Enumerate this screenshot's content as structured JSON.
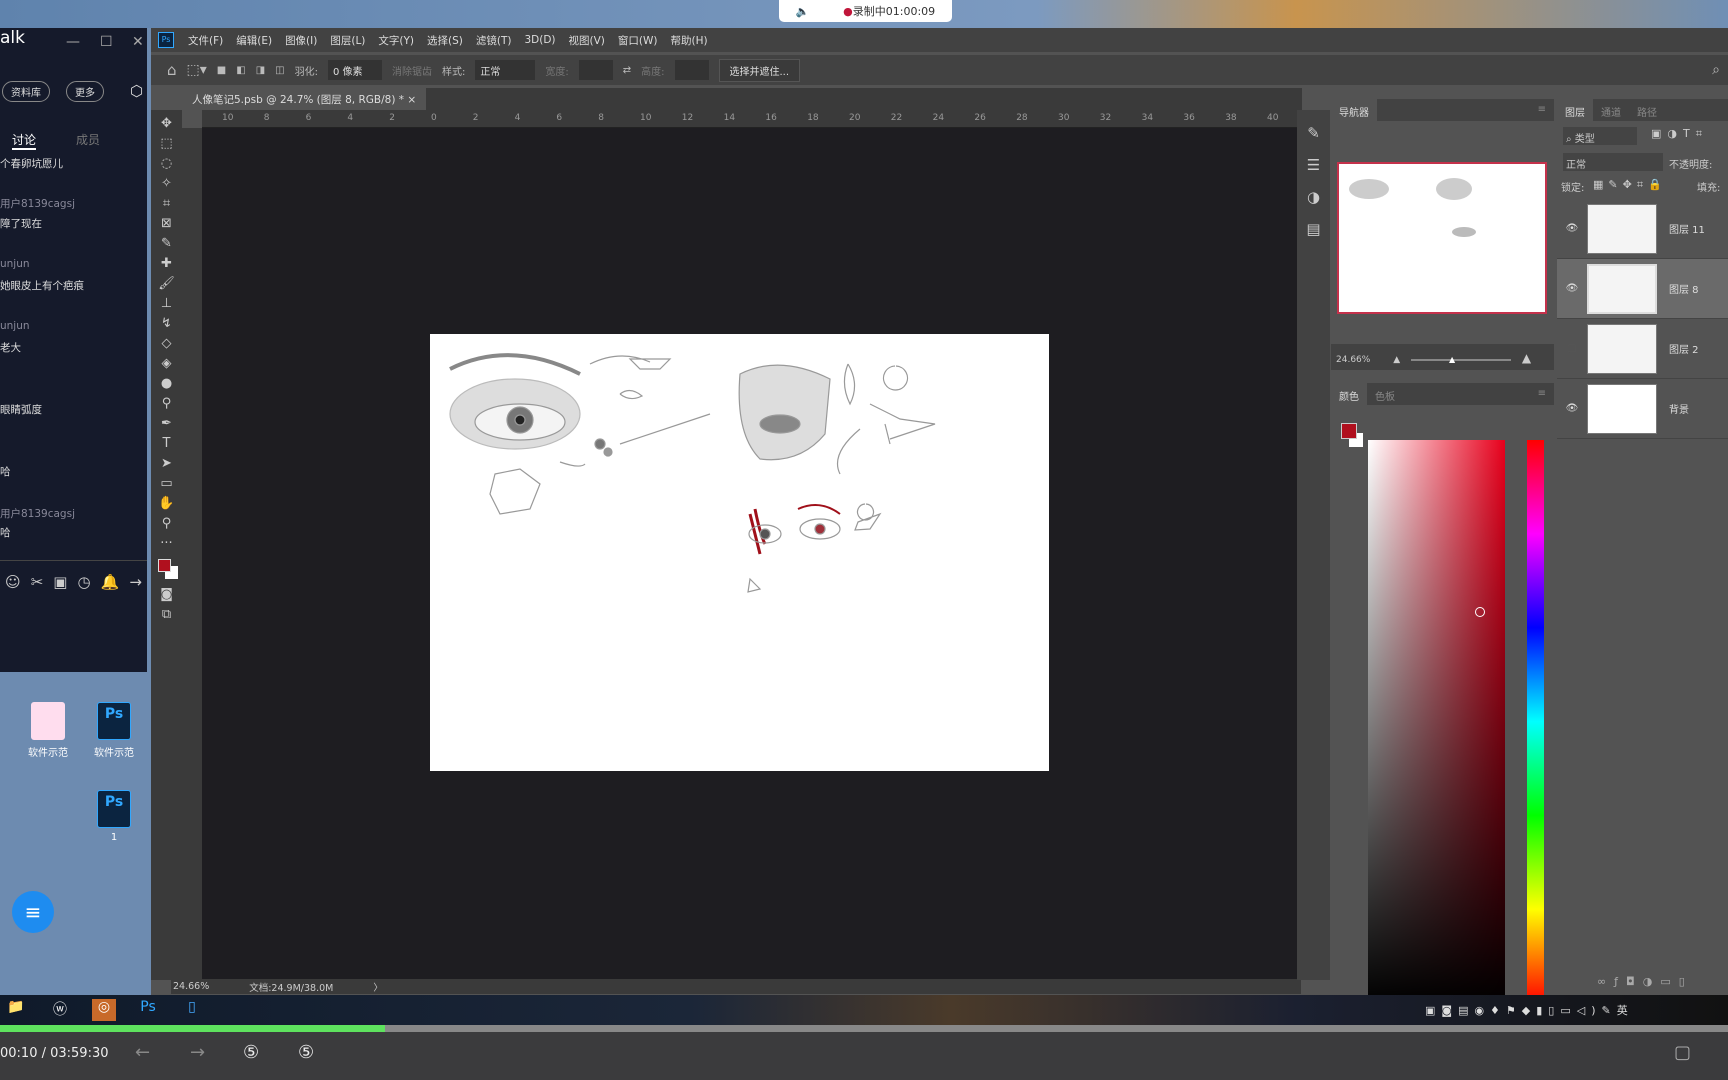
{
  "desktop": {
    "recording_text": "录制中01:00:09"
  },
  "chat": {
    "title": "alk",
    "buttons": [
      "资料库",
      "更多"
    ],
    "tabs": [
      "讨论",
      "成员"
    ],
    "messages": [
      {
        "user": "",
        "text": "个春卵坑愿儿"
      },
      {
        "user": "用户8139cagsj",
        "text": "障了现在"
      },
      {
        "user": "unjun",
        "text": "她眼皮上有个疤痕"
      },
      {
        "user": "unjun",
        "text": "老大"
      },
      {
        "user": "",
        "text": "眼睛弧度"
      },
      {
        "user": "",
        "text": "哈"
      },
      {
        "user": "用户8139cagsj",
        "text": "哈"
      }
    ]
  },
  "desktop_icons": [
    {
      "label": "软件示范",
      "type": "image"
    },
    {
      "label": "软件示范",
      "type": "psd"
    },
    {
      "label": "1",
      "type": "psd"
    }
  ],
  "ps": {
    "menu": [
      "文件(F)",
      "编辑(E)",
      "图像(I)",
      "图层(L)",
      "文字(Y)",
      "选择(S)",
      "滤镜(T)",
      "3D(D)",
      "视图(V)",
      "窗口(W)",
      "帮助(H)"
    ],
    "options": {
      "feather_label": "羽化:",
      "feather_value": "0 像素",
      "antialias": "消除锯齿",
      "style_label": "样式:",
      "style_value": "正常",
      "width_label": "宽度:",
      "height_label": "高度:",
      "select_mask": "选择并遮住..."
    },
    "doc_tab": "人像笔记5.psb @ 24.7% (图层 8, RGB/8) *",
    "ruler_top": [
      "10",
      "8",
      "6",
      "4",
      "2",
      "0",
      "2",
      "4",
      "6",
      "8",
      "10",
      "12",
      "14",
      "16",
      "18",
      "20",
      "22",
      "24",
      "26",
      "28",
      "30",
      "32",
      "34",
      "36",
      "38",
      "40"
    ],
    "status": {
      "zoom": "24.66%",
      "doc": "文档:24.9M/38.0M"
    },
    "navigator": {
      "tab": "导航器",
      "zoom": "24.66%"
    },
    "color": {
      "tabs": [
        "颜色",
        "色板"
      ],
      "foreground": "#b0101e",
      "background": "#ffffff"
    },
    "layers": {
      "tabs": [
        "图层",
        "通道",
        "路径"
      ],
      "filter": "类型",
      "blend": "正常",
      "opacity_label": "不透明度:",
      "lock_label": "锁定:",
      "fill_label": "填充:",
      "items": [
        {
          "name": "图层 11",
          "visible": true,
          "selected": false
        },
        {
          "name": "图层 8",
          "visible": true,
          "selected": true
        },
        {
          "name": "图层 2",
          "visible": false,
          "selected": false
        },
        {
          "name": "背景",
          "visible": true,
          "selected": false
        }
      ]
    }
  },
  "player": {
    "time": "00:10 / 03:59:30",
    "progress": 0.0047
  }
}
